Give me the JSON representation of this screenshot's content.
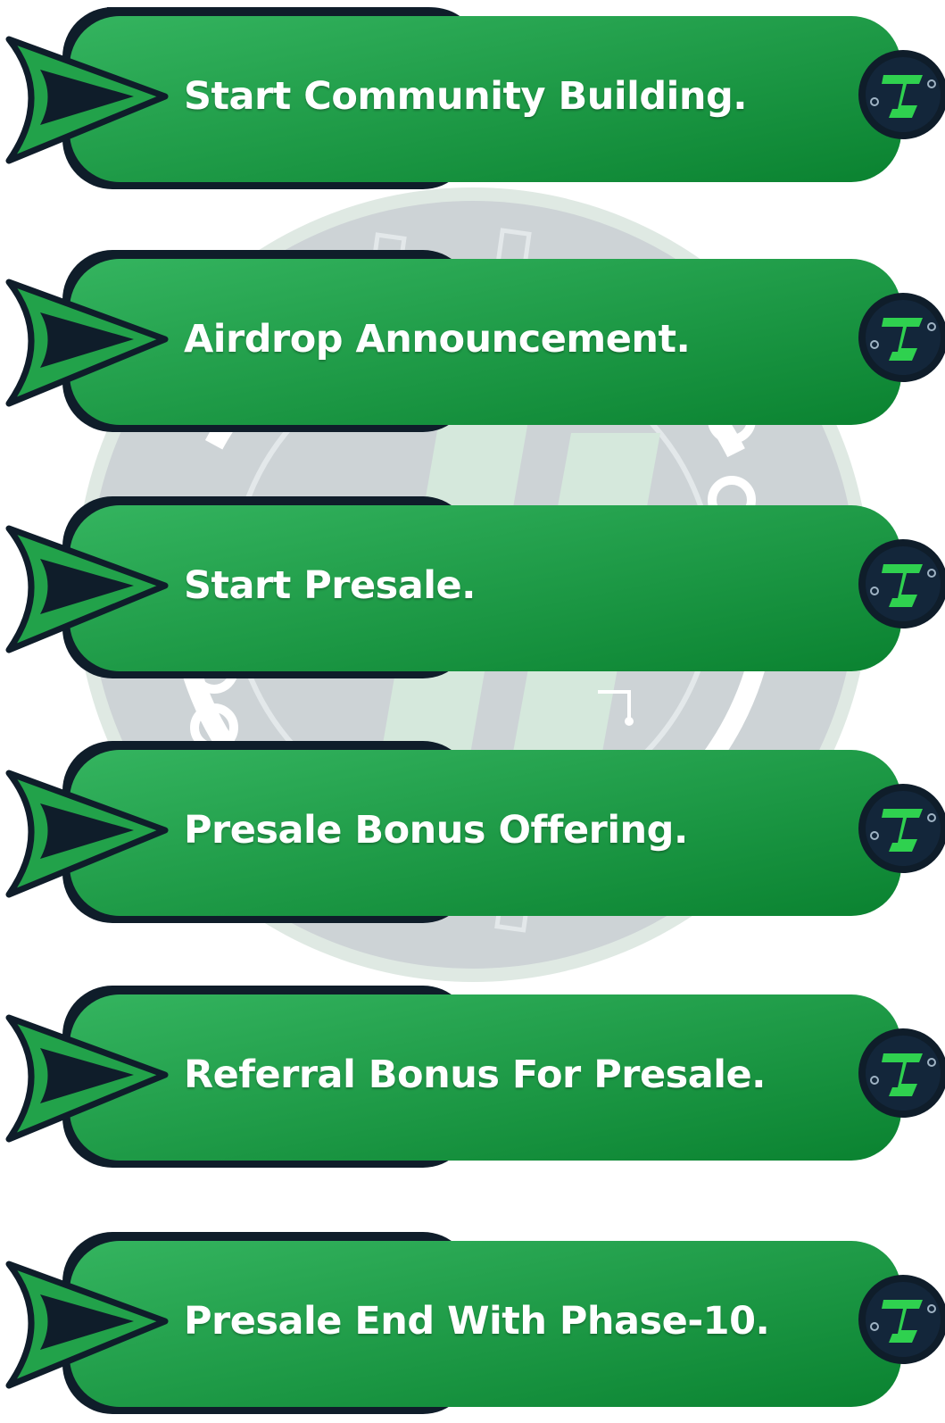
{
  "colors": {
    "accent_green": "#22a24a",
    "dark_navy": "#0f1d2a",
    "label_text": "#ffffff"
  },
  "background": {
    "icon": "circuit-emblem-watermark"
  },
  "steps": [
    {
      "label": "Start Community Building.",
      "arrow_icon": "arrow-pointer-icon",
      "badge_icon": "logo-badge-icon"
    },
    {
      "label": "Airdrop Announcement.",
      "arrow_icon": "arrow-pointer-icon",
      "badge_icon": "logo-badge-icon"
    },
    {
      "label": "Start Presale.",
      "arrow_icon": "arrow-pointer-icon",
      "badge_icon": "logo-badge-icon"
    },
    {
      "label": "Presale Bonus Offering.",
      "arrow_icon": "arrow-pointer-icon",
      "badge_icon": "logo-badge-icon"
    },
    {
      "label": "Referral Bonus For Presale.",
      "arrow_icon": "arrow-pointer-icon",
      "badge_icon": "logo-badge-icon"
    },
    {
      "label": "Presale End With Phase-10.",
      "arrow_icon": "arrow-pointer-icon",
      "badge_icon": "logo-badge-icon"
    }
  ]
}
